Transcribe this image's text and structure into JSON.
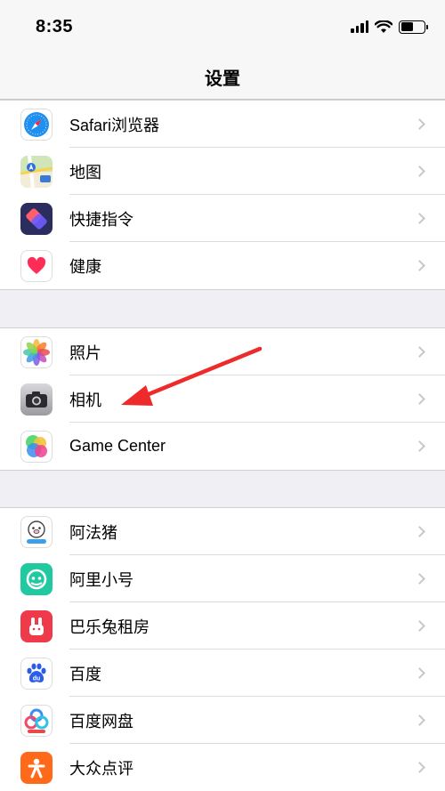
{
  "status": {
    "time": "8:35"
  },
  "nav": {
    "title": "设置"
  },
  "groups": [
    [
      {
        "label": "Safari浏览器",
        "icon": "safari-icon"
      },
      {
        "label": "地图",
        "icon": "maps-icon"
      },
      {
        "label": "快捷指令",
        "icon": "shortcuts-icon"
      },
      {
        "label": "健康",
        "icon": "health-icon"
      }
    ],
    [
      {
        "label": "照片",
        "icon": "photos-icon"
      },
      {
        "label": "相机",
        "icon": "camera-icon"
      },
      {
        "label": "Game Center",
        "icon": "game-center-icon"
      }
    ],
    [
      {
        "label": "阿法猪",
        "icon": "afazhu-icon"
      },
      {
        "label": "阿里小号",
        "icon": "alixiaohao-icon"
      },
      {
        "label": "巴乐兔租房",
        "icon": "baletu-icon"
      },
      {
        "label": "百度",
        "icon": "baidu-icon"
      },
      {
        "label": "百度网盘",
        "icon": "baidu-netdisk-icon"
      },
      {
        "label": "大众点评",
        "icon": "dianping-icon"
      }
    ]
  ],
  "colors": {
    "annotation_arrow": "#ee2b2b",
    "background": "#efeff4"
  }
}
